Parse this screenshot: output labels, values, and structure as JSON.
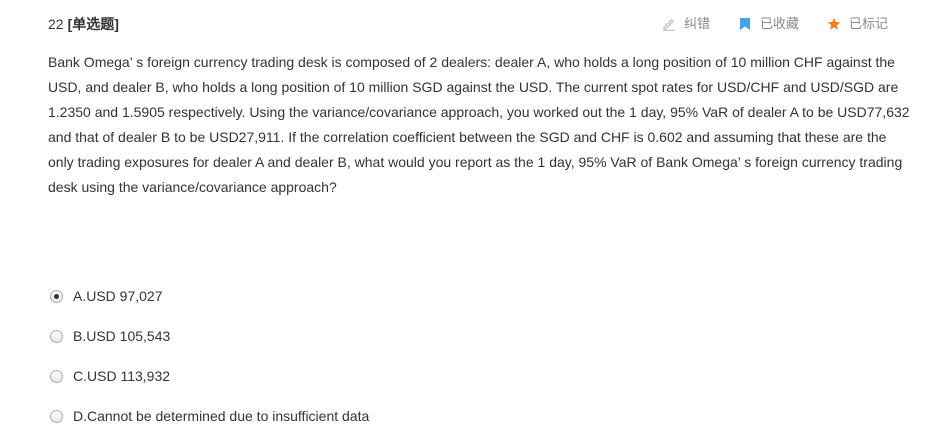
{
  "header": {
    "number": "22",
    "type": "[单选题]"
  },
  "actions": [
    {
      "label": "纠错",
      "icon": "pencil-icon",
      "color": "#bbbbbb"
    },
    {
      "label": "已收藏",
      "icon": "bookmark-icon",
      "color": "#4aa3df"
    },
    {
      "label": "已标记",
      "icon": "star-icon",
      "color": "#f07e1e"
    }
  ],
  "question": {
    "text": "Bank Omega’ s foreign currency trading desk is composed of 2 dealers: dealer A, who holds a long position of 10 million CHF against the USD, and dealer B, who holds a long position of 10 million SGD against the USD. The current spot rates for USD/CHF and USD/SGD are 1.2350 and 1.5905 respectively. Using the variance/covariance approach, you worked out the 1 day, 95% VaR of dealer A to be USD77,632 and that of dealer B to be USD27,911. If the correlation coefficient between the SGD and CHF is 0.602 and assuming that these are the only trading exposures for dealer A and dealer B, what would you report as the 1 day, 95% VaR of Bank Omega’ s foreign currency trading desk using the variance/covariance approach?"
  },
  "options": [
    {
      "label": "A.USD 97,027",
      "selected": true
    },
    {
      "label": "B.USD 105,543",
      "selected": false
    },
    {
      "label": "C.USD 113,932",
      "selected": false
    },
    {
      "label": "D.Cannot be determined due to insufficient data",
      "selected": false
    }
  ]
}
